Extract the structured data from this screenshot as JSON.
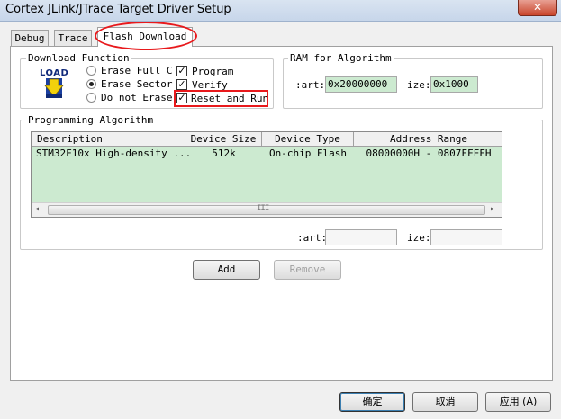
{
  "window": {
    "title": "Cortex JLink/JTrace Target Driver Setup",
    "close_glyph": "✕"
  },
  "tabs": [
    {
      "label": "Debug",
      "active": false
    },
    {
      "label": "Trace",
      "active": false
    },
    {
      "label": "Flash Download",
      "active": true
    }
  ],
  "download_function": {
    "legend": "Download Function",
    "load_icon_text": "LOAD",
    "radios": [
      {
        "label": "Erase Full C",
        "selected": false
      },
      {
        "label": "Erase Sector",
        "selected": true
      },
      {
        "label": "Do not Erase",
        "selected": false
      }
    ],
    "checks": [
      {
        "label": "Program",
        "checked": true
      },
      {
        "label": "Verify",
        "checked": true
      },
      {
        "label": "Reset and Run",
        "checked": true
      }
    ],
    "check_glyph": "✓"
  },
  "ram": {
    "legend": "RAM for Algorithm",
    "start_label": ":art:",
    "start_value": "0x20000000",
    "size_label": "ize:",
    "size_value": "0x1000"
  },
  "programming": {
    "legend": "Programming Algorithm",
    "columns": [
      "Description",
      "Device Size",
      "Device Type",
      "Address Range"
    ],
    "rows": [
      [
        "STM32F10x High-density ...",
        "512k",
        "On-chip Flash",
        "08000000H - 0807FFFFH"
      ]
    ],
    "scroll_left": "◂",
    "scroll_right": "▸",
    "scroll_grip": "III",
    "start_label": ":art:",
    "start_value": "",
    "size_label": "ize:",
    "size_value": ""
  },
  "buttons": {
    "add": "Add",
    "remove": "Remove",
    "ok": "确定",
    "cancel": "取消",
    "apply": "应用 (A)"
  },
  "colors": {
    "highlight_red": "#e8191c",
    "table_bg": "#ccead0"
  }
}
